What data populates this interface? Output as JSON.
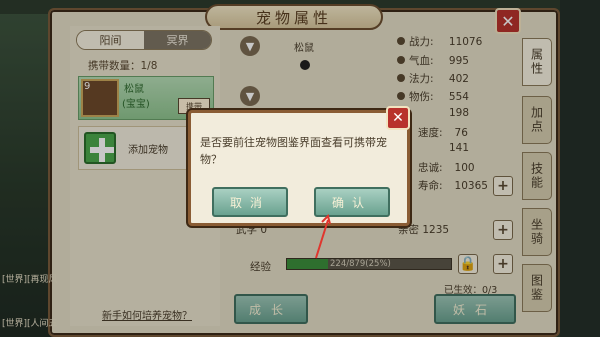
{
  "window": {
    "title": "宠物属性",
    "close": "✕"
  },
  "tabs": [
    "阳间",
    "冥界"
  ],
  "carry": "携带数量：1/8",
  "pet": {
    "level": "9",
    "name": "松鼠",
    "type": "(宝宝)",
    "tag": "携带"
  },
  "add_pet": "添加宠物",
  "help_link": "新手如何培养宠物？",
  "center": {
    "name": "松鼠"
  },
  "stats": [
    {
      "label": "战力:",
      "value": "11076"
    },
    {
      "label": "气血:",
      "value": "995"
    },
    {
      "label": "法力:",
      "value": "402"
    },
    {
      "label": "物伤:",
      "value": "554"
    },
    {
      "label": "",
      "value": "198"
    },
    {
      "label": "速度:",
      "value": "76"
    },
    {
      "label": "",
      "value": "141"
    },
    {
      "label": "忠诚:",
      "value": "100"
    },
    {
      "label": "寿命:",
      "value": "10365"
    }
  ],
  "lower": {
    "left": "武学 0",
    "right": "亲密 1235"
  },
  "exp": {
    "label": "经验",
    "text": "224/879(25%)",
    "fraction": 0.25
  },
  "alive": "已生效：0/3",
  "buttons": {
    "grow": "成长",
    "demon_stone": "妖石"
  },
  "side_tabs": [
    "属性",
    "加点",
    "技能",
    "坐骑",
    "图鉴"
  ],
  "chat": {
    "line1": "[世界][再现风",
    "line2": "[世界][人间五"
  },
  "dialog": {
    "message": "是否要前往宠物图鉴界面查看可携带宠物？",
    "cancel": "取消",
    "confirm": "确认",
    "close": "✕"
  },
  "colors": {
    "accent_green": "#6aa290",
    "close_red": "#b8322c",
    "frame_brown": "#8a5c34"
  }
}
